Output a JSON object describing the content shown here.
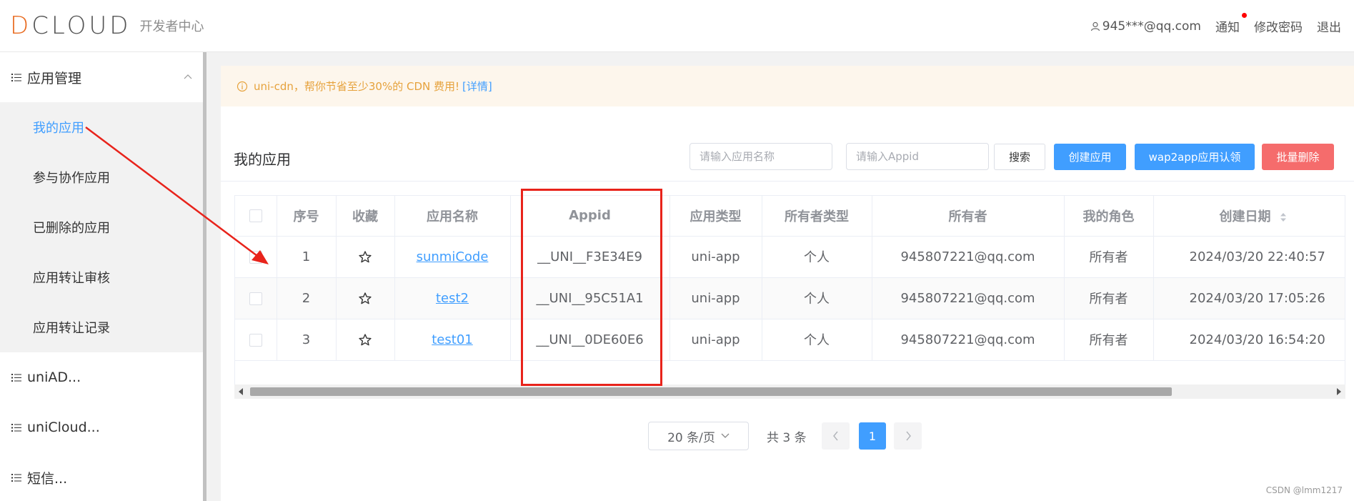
{
  "header": {
    "logo_text": "DCLOUD",
    "subtitle": "开发者中心",
    "user_email": "945***@qq.com",
    "notify_label": "通知",
    "change_password_label": "修改密码",
    "logout_label": "退出"
  },
  "sidebar": {
    "groups": [
      {
        "label": "应用管理",
        "expanded": true,
        "icon": "list-icon"
      },
      {
        "label": "uniAD...",
        "icon": "list-icon"
      },
      {
        "label": "uniCloud...",
        "icon": "list-icon"
      },
      {
        "label": "短信...",
        "icon": "list-icon"
      }
    ],
    "items": [
      {
        "label": "我的应用",
        "active": true
      },
      {
        "label": "参与协作应用"
      },
      {
        "label": "已删除的应用"
      },
      {
        "label": "应用转让审核"
      },
      {
        "label": "应用转让记录"
      }
    ]
  },
  "notice": {
    "text": "uni-cdn，帮你节省至少30%的 CDN 费用!",
    "link": "[详情]",
    "icon": "info-icon"
  },
  "main": {
    "title": "我的应用",
    "search_name_placeholder": "请输入应用名称",
    "search_appid_placeholder": "请输入Appid",
    "search_button": "搜索",
    "create_button": "创建应用",
    "wap2app_button": "wap2app应用认领",
    "batch_delete_button": "批量删除"
  },
  "table": {
    "columns": [
      "序号",
      "收藏",
      "应用名称",
      "Appid",
      "应用类型",
      "所有者类型",
      "所有者",
      "我的角色",
      "创建日期"
    ],
    "rows": [
      {
        "index": "1",
        "name": "sunmiCode",
        "appid": "__UNI__F3E34E9",
        "type": "uni-app",
        "owner_type": "个人",
        "owner": "945807221@qq.com",
        "role": "所有者",
        "created": "2024/03/20 22:40:57"
      },
      {
        "index": "2",
        "name": "test2",
        "appid": "__UNI__95C51A1",
        "type": "uni-app",
        "owner_type": "个人",
        "owner": "945807221@qq.com",
        "role": "所有者",
        "created": "2024/03/20 17:05:26"
      },
      {
        "index": "3",
        "name": "test01",
        "appid": "__UNI__0DE60E6",
        "type": "uni-app",
        "owner_type": "个人",
        "owner": "945807221@qq.com",
        "role": "所有者",
        "created": "2024/03/20 16:54:20"
      }
    ]
  },
  "pagination": {
    "page_size": "20 条/页",
    "total": "共 3 条",
    "current_page": "1"
  },
  "watermark": "CSDN @lmm1217",
  "colors": {
    "accent": "#409eff",
    "danger": "#f56c6c",
    "highlight": "#e8231b",
    "logo_accent": "#e86a1f"
  }
}
